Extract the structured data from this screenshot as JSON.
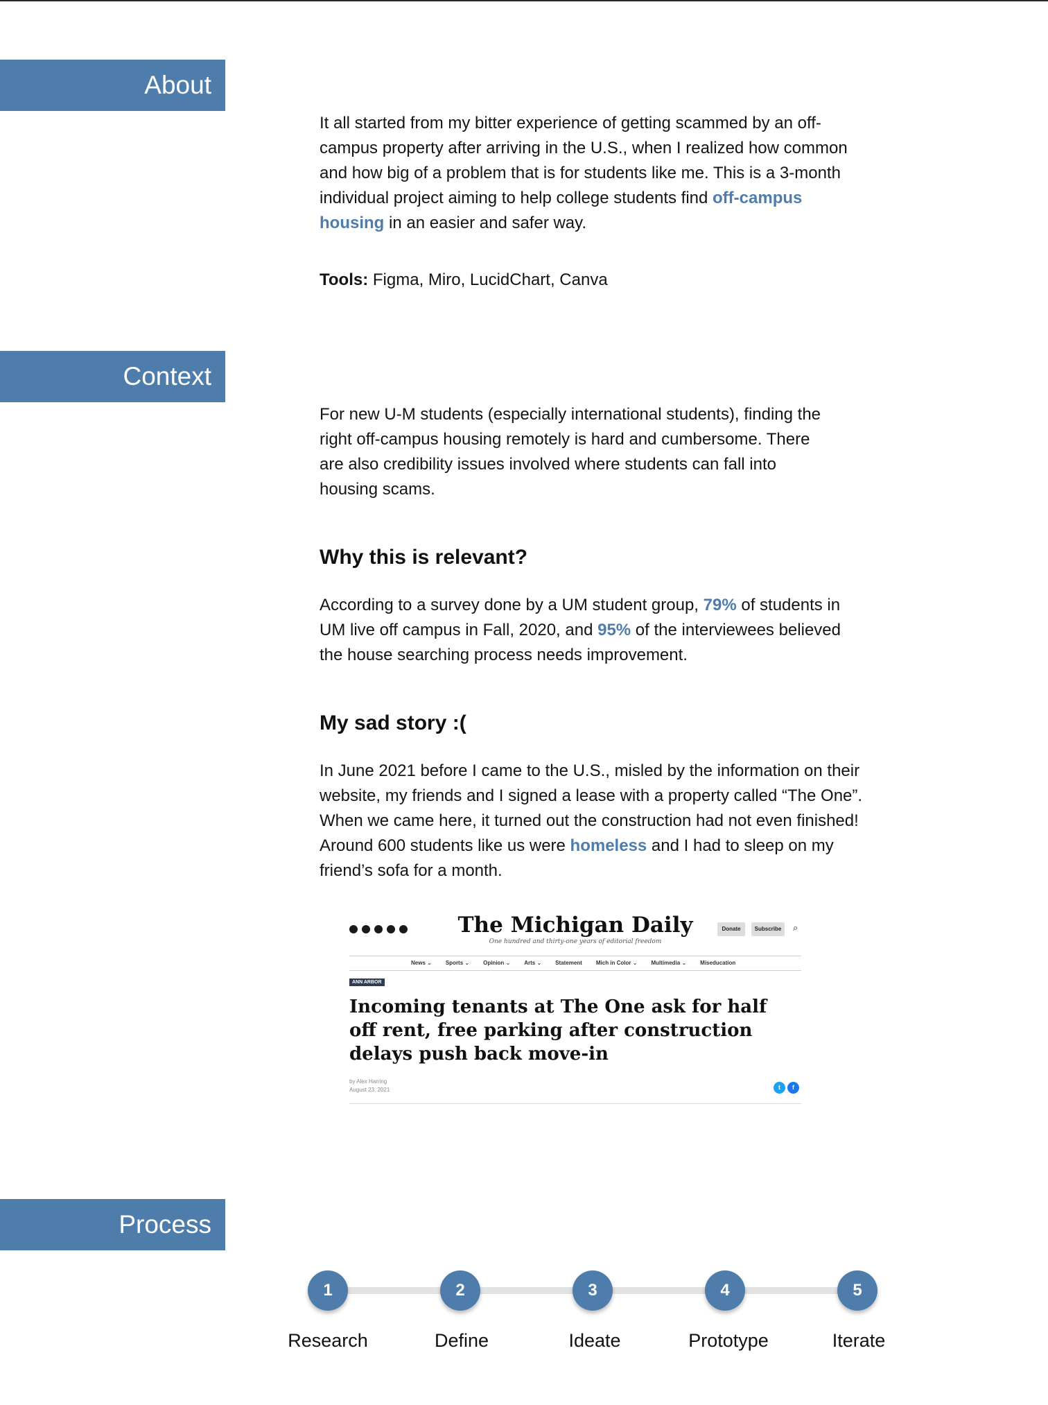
{
  "about": {
    "heading": "About",
    "p1": "It all started from my bitter experience of getting scammed by an off-campus property after arriving in the U.S., when I realized how common and how big of a problem that is for students like me. This is a 3-month individual project aiming to help college students find ",
    "p1_link": "off-campus housing",
    "p1_end": " in an easier and safer way.",
    "tools_label": "Tools:",
    "tools_value": " Figma, Miro, LucidChart, Canva"
  },
  "context": {
    "heading": "Context",
    "p1": "For new U-M students (especially international students), finding the right off-campus housing remotely is hard and cumbersome. There are also credibility issues involved where students can fall into housing scams.",
    "relevant_heading": "Why this is relevant?",
    "relevant_a": "According to a survey done by a UM student group, ",
    "relevant_stat1": "79%",
    "relevant_b": " of students in UM live off campus in Fall, 2020, and ",
    "relevant_stat2": "95%",
    "relevant_c": " of the interviewees believed the house searching process needs improvement.",
    "story_heading": "My sad story :(",
    "story_a": "In June 2021 before I came to the U.S., misled by the information on their website, my friends and I signed a lease with a property called “The One”. When we came here, it turned out the construction had not even finished! Around 600 students like us were ",
    "story_hl": "homeless",
    "story_b": " and I had to sleep on my friend’s sofa for a month."
  },
  "news": {
    "masthead": "The Michigan Daily",
    "tagline": "One hundred and thirty-one years of editorial freedom",
    "donate": "Donate",
    "subscribe": "Subscribe",
    "nav": [
      "News ⌄",
      "Sports ⌄",
      "Opinion ⌄",
      "Arts ⌄",
      "Statement",
      "Mich in Color ⌄",
      "Multimedia ⌄",
      "Miseducation"
    ],
    "tag": "ANN ARBOR",
    "headline": "Incoming tenants at The One ask for half off rent, free parking after construction delays push back move-in",
    "author": "by Alex Harring",
    "date": "August 23, 2021"
  },
  "process": {
    "heading": "Process",
    "steps": [
      {
        "num": "1",
        "label": "Research"
      },
      {
        "num": "2",
        "label": "Define"
      },
      {
        "num": "3",
        "label": "Ideate"
      },
      {
        "num": "4",
        "label": "Prototype"
      },
      {
        "num": "5",
        "label": "Iterate"
      }
    ]
  },
  "colors": {
    "accent": "#4e7dac"
  }
}
